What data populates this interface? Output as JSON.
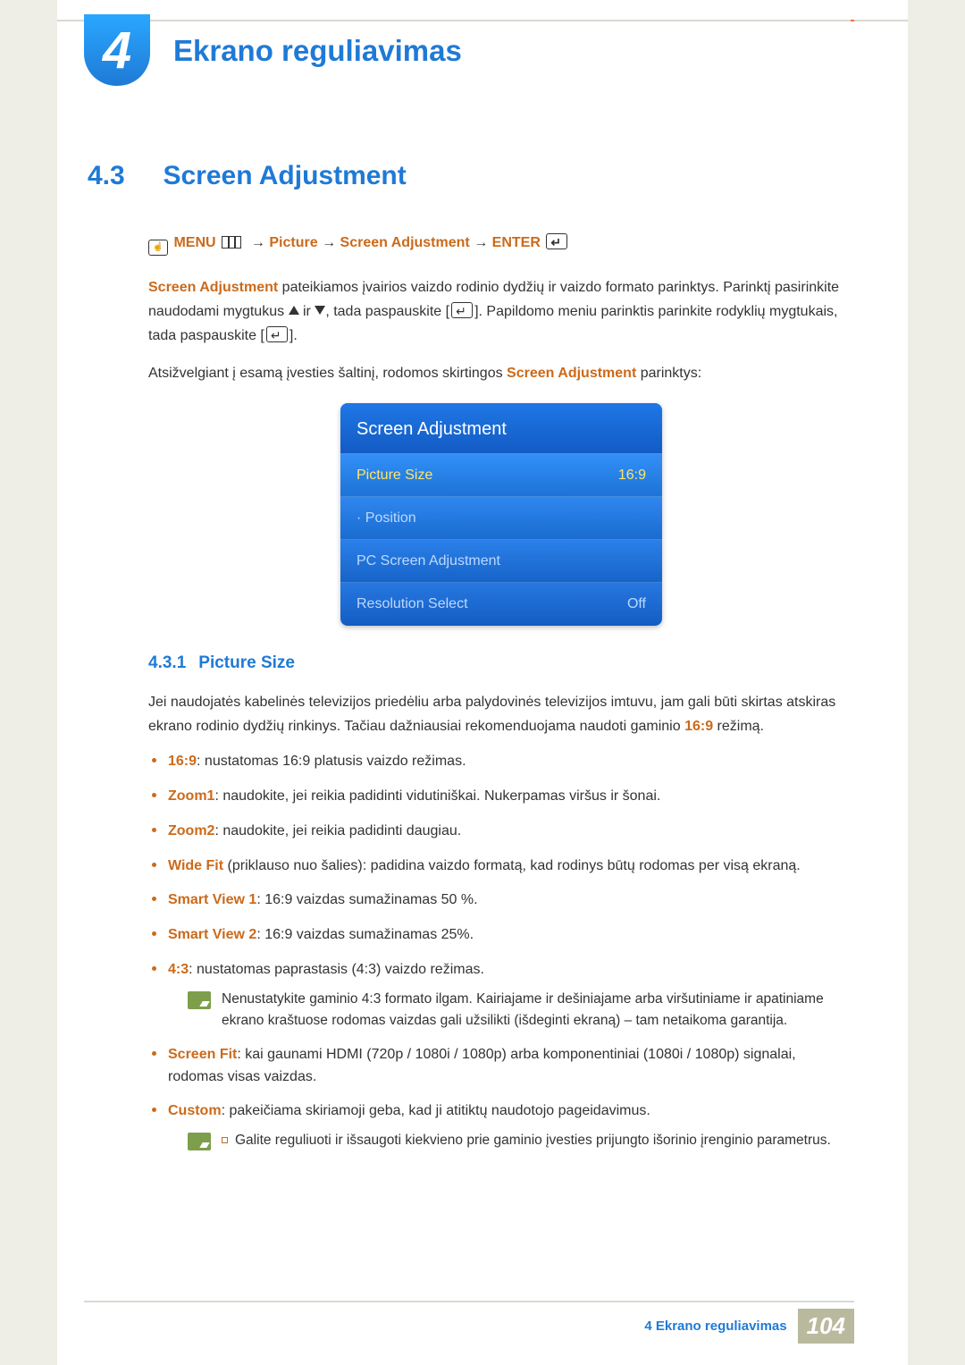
{
  "chapter": {
    "number": "4",
    "title": "Ekrano reguliavimas"
  },
  "section": {
    "number": "4.3",
    "title": "Screen Adjustment"
  },
  "nav": {
    "menu": "MENU",
    "step1": "Picture",
    "step2": "Screen Adjustment",
    "enter": "ENTER"
  },
  "para1a": "Screen Adjustment",
  "para1b": " pateikiamos įvairios vaizdo rodinio dydžių ir vaizdo formato parinktys. Parinktį pasirinkite naudodami mygtukus ",
  "para1c": " ir ",
  "para1d": ", tada paspauskite [",
  "para1e": "]. Papildomo meniu parinktis parinkite rodyklių mygtukais, tada paspauskite [",
  "para1f": "].",
  "para2a": "Atsižvelgiant į esamą įvesties šaltinį, rodomos skirtingos ",
  "para2b": "Screen Adjustment",
  "para2c": " parinktys:",
  "osd": {
    "title": "Screen Adjustment",
    "rows": [
      {
        "label": "Picture Size",
        "value": "16:9",
        "highlight": true
      },
      {
        "label": "· Position",
        "value": "",
        "dim": true
      },
      {
        "label": "PC Screen Adjustment",
        "value": "",
        "dim": true
      },
      {
        "label": "Resolution Select",
        "value": "Off",
        "dim": true
      }
    ]
  },
  "subsection": {
    "number": "4.3.1",
    "title": "Picture Size"
  },
  "ps_intro_a": "Jei naudojatės kabelinės televizijos priedėliu arba palydovinės televizijos imtuvu, jam gali būti skirtas atskiras ekrano rodinio dydžių rinkinys. Tačiau dažniausiai rekomenduojama naudoti gaminio ",
  "ps_intro_kw": "16:9",
  "ps_intro_b": " režimą.",
  "options": [
    {
      "kw": "16:9",
      "text": ": nustatomas 16:9 platusis vaizdo režimas."
    },
    {
      "kw": "Zoom1",
      "text": ": naudokite, jei reikia padidinti vidutiniškai. Nukerpamas viršus ir šonai."
    },
    {
      "kw": "Zoom2",
      "text": ": naudokite, jei reikia padidinti daugiau."
    },
    {
      "kw": "Wide Fit",
      "text": " (priklauso nuo šalies): padidina vaizdo formatą, kad rodinys būtų rodomas per visą ekraną."
    },
    {
      "kw": "Smart View 1",
      "text": ": 16:9 vaizdas sumažinamas 50 %."
    },
    {
      "kw": "Smart View 2",
      "text": ": 16:9 vaizdas sumažinamas 25%."
    },
    {
      "kw": "4:3",
      "text": ": nustatomas paprastasis (4:3) vaizdo režimas."
    }
  ],
  "note1": "Nenustatykite gaminio 4:3 formato ilgam. Kairiajame ir dešiniajame arba viršutiniame ir apatiniame ekrano kraštuose rodomas vaizdas gali užsilikti (išdeginti ekraną) – tam netaikoma garantija.",
  "options2": [
    {
      "kw": "Screen Fit",
      "text": ": kai gaunami HDMI (720p / 1080i / 1080p) arba komponentiniai (1080i / 1080p) signalai, rodomas visas vaizdas."
    },
    {
      "kw": "Custom",
      "text": ": pakeičiama skiriamoji geba, kad ji atitiktų naudotojo pageidavimus."
    }
  ],
  "note2": "Galite reguliuoti ir išsaugoti kiekvieno prie gaminio įvesties prijungto išorinio įrenginio parametrus.",
  "footer": {
    "text": "4 Ekrano reguliavimas",
    "page": "104"
  }
}
